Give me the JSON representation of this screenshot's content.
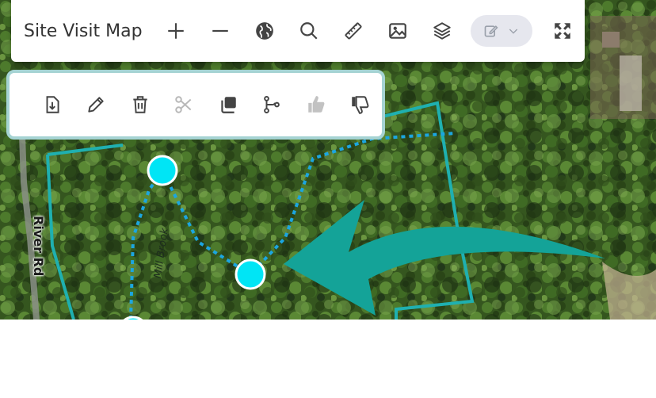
{
  "toolbar": {
    "title": "Site Visit Map",
    "buttons": [
      "plus-icon",
      "minus-icon",
      "globe-icon",
      "search-icon",
      "ruler-icon",
      "image-icon",
      "layers-icon"
    ],
    "edit_dropdown": "pencil-icon",
    "fullscreen": "expand-icon"
  },
  "edit_panel": {
    "buttons": [
      "download-icon",
      "pencil-icon",
      "trash-icon",
      "scissors-icon",
      "copy-icon",
      "branch-icon",
      "thumbs-up-icon",
      "thumbs-down-icon"
    ]
  },
  "map": {
    "labels": {
      "road": "River Rd",
      "stream": "Mill Brook"
    },
    "colors": {
      "boundary": "#1fb0b0",
      "path": "#1ca6e0",
      "waypoint": "#00e5f5",
      "arrow": "#14a398"
    }
  }
}
